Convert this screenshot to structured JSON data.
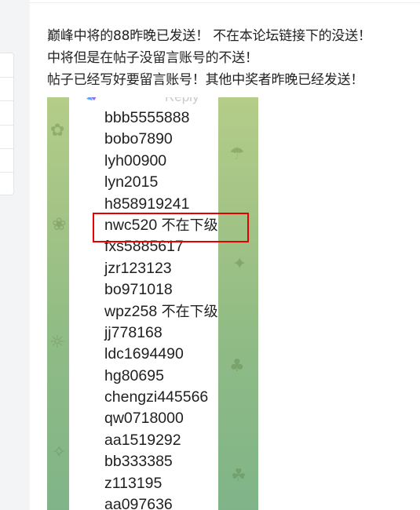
{
  "post": {
    "lines": [
      "巅峰中将的88昨晚已发送！ 不在本论坛链接下的没送！",
      "中将但是在帖子没留言账号的不送！",
      "帖子已经写好要留言账号！其他中奖者昨晚已经发送！"
    ]
  },
  "image": {
    "reply_label": "Reply",
    "names": [
      {
        "account": "bbb5555888",
        "note": ""
      },
      {
        "account": "bobo7890",
        "note": ""
      },
      {
        "account": "lyh00900",
        "note": ""
      },
      {
        "account": "lyn2015",
        "note": ""
      },
      {
        "account": "h858919241",
        "note": ""
      },
      {
        "account": "nwc520",
        "note": "不在下级"
      },
      {
        "account": "fxs5885617",
        "note": ""
      },
      {
        "account": "jzr123123",
        "note": ""
      },
      {
        "account": "bo971018",
        "note": ""
      },
      {
        "account": "wpz258",
        "note": "不在下级"
      },
      {
        "account": "jj778168",
        "note": ""
      },
      {
        "account": "ldc1694490",
        "note": ""
      },
      {
        "account": "hg80695",
        "note": ""
      },
      {
        "account": "chengzi445566",
        "note": ""
      },
      {
        "account": "qw0718000",
        "note": ""
      },
      {
        "account": "aa1519292",
        "note": ""
      },
      {
        "account": "bb333385",
        "note": ""
      },
      {
        "account": "z113195",
        "note": ""
      },
      {
        "account": "aa097636",
        "note": ""
      }
    ],
    "highlighted_account": "nwc520",
    "highlight_color": "#e60000"
  },
  "colors": {
    "page_background": "#f3f4f6",
    "content_background": "#ffffff",
    "chat_background": "#9ec084",
    "text": "#222222"
  }
}
